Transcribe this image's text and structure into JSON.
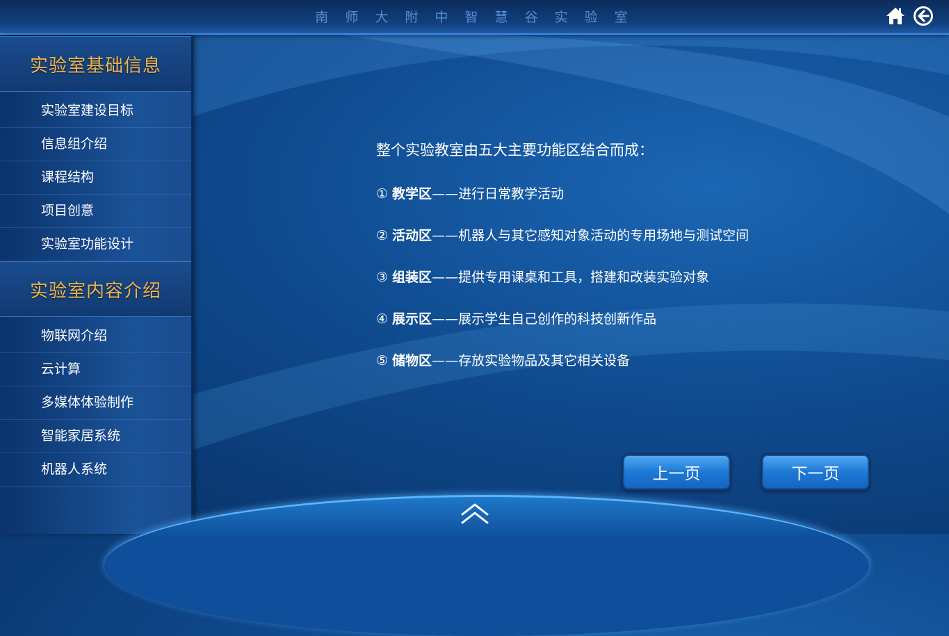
{
  "header": {
    "title": "南 师 大 附 中 智 慧 谷 实 验 室",
    "home_icon": "home-icon",
    "back_icon": "back-arrow-icon"
  },
  "sidebar": {
    "sections": [
      {
        "heading": "实验室基础信息",
        "items": [
          "实验室建设目标",
          "信息组介绍",
          "课程结构",
          "项目创意",
          "实验室功能设计"
        ]
      },
      {
        "heading": "实验室内容介绍",
        "items": [
          "物联网介绍",
          "云计算",
          "多媒体体验制作",
          "智能家居系统",
          "机器人系统"
        ]
      }
    ]
  },
  "main": {
    "intro": "整个实验教室由五大主要功能区结合而成：",
    "zones": [
      {
        "num": "①",
        "name": "教学区",
        "desc": "——进行日常教学活动"
      },
      {
        "num": "②",
        "name": "活动区",
        "desc": "——机器人与其它感知对象活动的专用场地与测试空间"
      },
      {
        "num": "③",
        "name": "组装区",
        "desc": "——提供专用课桌和工具，搭建和改装实验对象"
      },
      {
        "num": "④",
        "name": "展示区",
        "desc": "——展示学生自己创作的科技创新作品"
      },
      {
        "num": "⑤",
        "name": "储物区",
        "desc": "——存放实验物品及其它相关设备"
      }
    ]
  },
  "nav": {
    "prev_label": "上一页",
    "next_label": "下一页",
    "up_icon": "chevron-up-icon"
  },
  "colors": {
    "section_heading": "#f1b44a",
    "title": "#4f8fd6",
    "button": "#1d79d6"
  }
}
